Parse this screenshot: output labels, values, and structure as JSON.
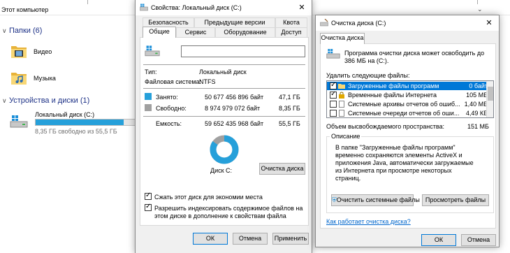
{
  "explorer": {
    "title": "Этот компьютер",
    "folders_header": "Папки (6)",
    "folders": [
      {
        "label": "Видео",
        "icon": "video-folder-icon"
      },
      {
        "label": "Музыка",
        "icon": "music-folder-icon"
      }
    ],
    "devices_header": "Устройства и диски (1)",
    "drive": {
      "name": "Локальный диск (C:)",
      "free_text": "8,35 ГБ свободно из 55,5 ГБ",
      "used_fraction": 0.85
    }
  },
  "properties": {
    "title": "Свойства: Локальный диск (C:)",
    "tabs_top": [
      "Безопасность",
      "Предыдущие версии",
      "Квота"
    ],
    "tabs_bottom": [
      "Общие",
      "Сервис",
      "Оборудование",
      "Доступ"
    ],
    "name_value": "",
    "type_label": "Тип:",
    "type_value": "Локальный диск",
    "fs_label": "Файловая система:",
    "fs_value": "NTFS",
    "used_label": "Занято:",
    "used_bytes": "50 677 456 896 байт",
    "used_gb": "47,1 ГБ",
    "free_label": "Свободно:",
    "free_bytes": "8 974 979 072 байт",
    "free_gb": "8,35 ГБ",
    "capacity_label": "Емкость:",
    "capacity_bytes": "59 652 435 968 байт",
    "capacity_gb": "55,5 ГБ",
    "disk_label": "Диск C:",
    "cleanup_button": "Очистка диска",
    "compress_label": "Сжать этот диск для экономии места",
    "index_label": "Разрешить индексировать содержимое файлов на этом диске в дополнение к свойствам файла",
    "ok": "ОК",
    "cancel": "Отмена",
    "apply": "Применить",
    "colors": {
      "used": "#26a0da",
      "free": "#a0a0a0"
    }
  },
  "cleanup": {
    "title": "Очистка диска  (C:)",
    "tab": "Очистка диска",
    "intro": "Программа очистки диска может освободить до 386 МБ на  (C:).",
    "delete_label": "Удалить следующие файлы:",
    "items": [
      {
        "name": "Загруженные файлы программ",
        "size": "0 байт",
        "checked": true,
        "selected": true
      },
      {
        "name": "Временные файлы Интернета",
        "size": "105 МБ",
        "checked": true,
        "selected": false
      },
      {
        "name": "Системные архивы отчетов об ошиб...",
        "size": "1,40 МБ",
        "checked": false,
        "selected": false
      },
      {
        "name": "Системные очереди отчетов об оши...",
        "size": "4,49 КБ",
        "checked": false,
        "selected": false
      }
    ],
    "space_label": "Объем высвобождаемого пространства:",
    "space_value": "151 МБ",
    "description_title": "Описание",
    "description_text": "В папке \"Загруженные файлы программ\" временно сохраняются элементы ActiveX и приложения Java, автоматически загружаемые из Интернета при просмотре некоторых страниц.",
    "system_button": "Очистить системные файлы",
    "view_button": "Просмотреть файлы",
    "help_link": "Как работает очистка диска?",
    "ok": "ОК",
    "cancel": "Отмена"
  }
}
